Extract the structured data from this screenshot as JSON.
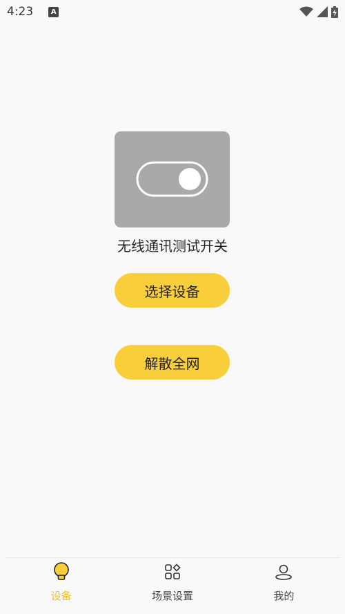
{
  "status_bar": {
    "time": "4:23",
    "notification_icon": "A"
  },
  "device": {
    "icon": "toggle-switch-icon",
    "title": "无线通讯测试开关"
  },
  "actions": {
    "select_device": "选择设备",
    "dissolve_network": "解散全网"
  },
  "tabs": [
    {
      "label": "设备",
      "icon": "lightbulb-icon",
      "active": true
    },
    {
      "label": "场景设置",
      "icon": "grid-icon",
      "active": false
    },
    {
      "label": "我的",
      "icon": "person-icon",
      "active": false
    }
  ],
  "colors": {
    "accent": "#f8cf3a",
    "active_tab": "#f3c026",
    "card_gray": "#a9a9a9",
    "background": "#f9f9f9"
  }
}
